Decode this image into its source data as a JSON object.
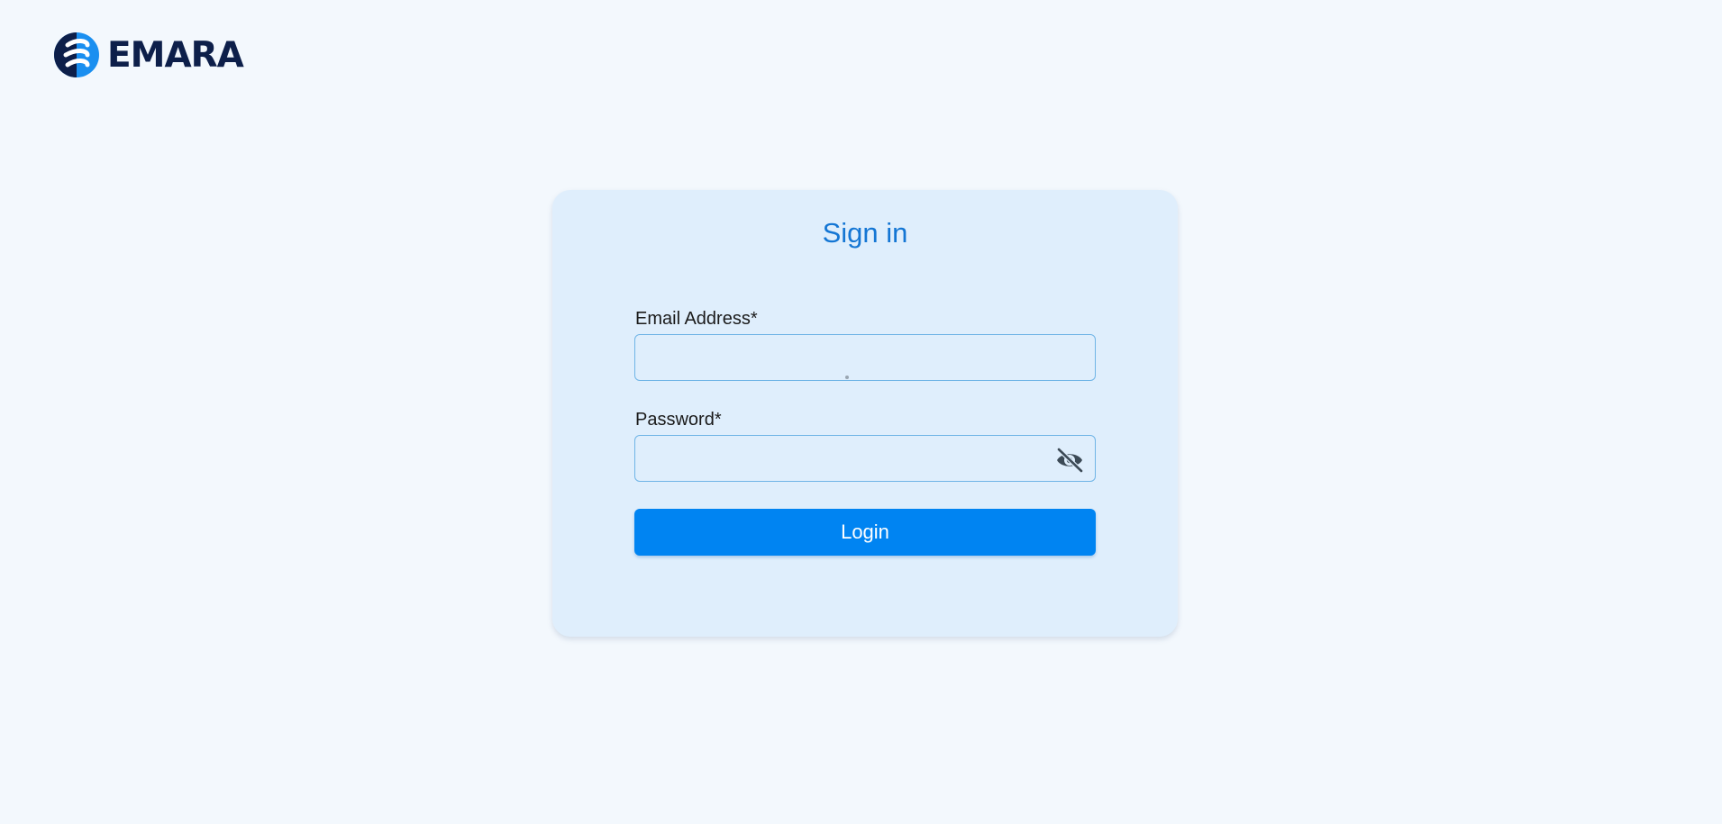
{
  "brand": {
    "name": "EMARA",
    "logo_icon": "emara-logo-icon",
    "colors": {
      "mark": "#1a8ff0",
      "text": "#0d1f4a"
    }
  },
  "signin": {
    "title": "Sign in",
    "email": {
      "label": "Email Address*",
      "value": "",
      "placeholder": ""
    },
    "password": {
      "label": "Password*",
      "value": "",
      "placeholder": "",
      "toggle_icon": "eye-off-icon"
    },
    "login_label": "Login"
  },
  "colors": {
    "accent": "#0084f2",
    "title": "#1476d4",
    "card_background": "#dfeefc",
    "page_background": "#f3f8fd"
  }
}
